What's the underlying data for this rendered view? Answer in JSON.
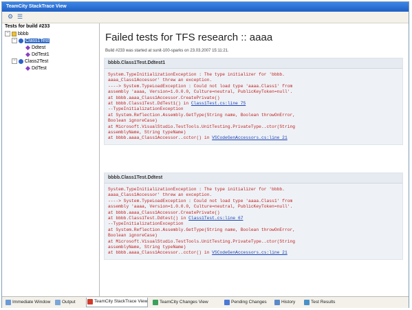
{
  "window": {
    "title": "TeamCity StackTrace View"
  },
  "toolbar": {
    "buttons": [
      {
        "icon": "settings-icon",
        "glyph": "⚙"
      },
      {
        "icon": "list-icon",
        "glyph": "☰"
      }
    ]
  },
  "tree": {
    "header": "Tests for build #233",
    "nodes": [
      {
        "label": "bbbb",
        "kind": "folder"
      },
      {
        "label": "Class1Test",
        "kind": "class",
        "selected": true
      },
      {
        "label": "Ddtest",
        "kind": "method"
      },
      {
        "label": "DdTest1",
        "kind": "method"
      },
      {
        "label": "Class2Test",
        "kind": "class"
      },
      {
        "label": "DdTest",
        "kind": "method"
      }
    ]
  },
  "main": {
    "title": "Failed tests for TFS research :: aaaa",
    "subtitle": "Build #233 was started at sunit-100-sparks on 23.03.2007 15:11:21.",
    "failures": [
      {
        "header": "bbbb.Class1Test.Ddtest1",
        "lines": [
          {
            "text": "System.TypeInitializationException : The type initializer for 'bbbb."
          },
          {
            "text": "aaaa_Class1Accessor' threw an exception."
          },
          {
            "text": "----> System.TypeLoadException : Could not load type 'aaaa.Class1' from"
          },
          {
            "text": "assembly 'aaaa, Version=1.0.0.0, Culture=neutral, PublicKeyToken=null'."
          },
          {
            "text": "at bbbb.aaaa_Class1Accessor.CreatePrivate()"
          },
          {
            "text": "at bbbb.Class1Test.DdTest1() in ",
            "link": "Class1Test.cs:line 75"
          },
          {
            "text": "--TypeInitializationException"
          },
          {
            "text": "at System.Reflection.Assembly.GetType(String name, Boolean throwOnError,"
          },
          {
            "text": "Boolean ignoreCase)"
          },
          {
            "text": "at Microsoft.VisualStudio.TestTools.UnitTesting.PrivateType..ctor(String"
          },
          {
            "text": "assemblyName, String typeName)"
          },
          {
            "text": "at bbbb.aaaa_Class1Accessor..cctor() in ",
            "link": "VSCodeGenAccessors.cs:line 21"
          }
        ]
      },
      {
        "header": "bbbb.Class1Test.Ddtest",
        "lines": [
          {
            "text": "System.TypeInitializationException : The type initializer for 'bbbb."
          },
          {
            "text": "aaaa_Class1Accessor' threw an exception."
          },
          {
            "text": "----> System.TypeLoadException : Could not load type 'aaaa.Class1' from"
          },
          {
            "text": "assembly 'aaaa, Version=1.0.0.0, Culture=neutral, PublicKeyToken=null'."
          },
          {
            "text": "at bbbb.aaaa_Class1Accessor.CreatePrivate()"
          },
          {
            "text": "at bbbb.Class1Test.Ddtest() in ",
            "link": "Class1Test.cs:line 67"
          },
          {
            "text": "--TypeInitializationException"
          },
          {
            "text": "at System.Reflection.Assembly.GetType(String name, Boolean throwOnError,"
          },
          {
            "text": "Boolean ignoreCase)"
          },
          {
            "text": "at Microsoft.VisualStudio.TestTools.UnitTesting.PrivateType..ctor(String"
          },
          {
            "text": "assemblyName, String typeName)"
          },
          {
            "text": "at bbbb.aaaa_Class1Accessor..cctor() in ",
            "link": "VSCodeGenAccessors.cs:line 21"
          }
        ]
      }
    ]
  },
  "bottom_tabs": [
    {
      "label": "Immediate Window",
      "icon": "immediate-window-icon",
      "color": "#6a9ad8"
    },
    {
      "label": "Output",
      "icon": "output-icon",
      "color": "#7aa6d8"
    },
    {
      "label": "TeamCity StackTrace View",
      "icon": "teamcity-icon",
      "color": "#d23a2a",
      "active": true
    },
    {
      "label": "TeamCity Changes View",
      "icon": "changes-icon",
      "color": "#3aa05a"
    },
    {
      "label": "Pending Changes",
      "icon": "pending-changes-icon",
      "color": "#4a7ad8"
    },
    {
      "label": "History",
      "icon": "history-icon",
      "color": "#5a8ac8"
    },
    {
      "label": "Test Results",
      "icon": "test-results-icon",
      "color": "#4a90c8"
    }
  ],
  "colors": {
    "titlebar": "#2f6fd6",
    "error_text": "#c02020",
    "link": "#1b3fb0",
    "selection": "#316ac5"
  }
}
